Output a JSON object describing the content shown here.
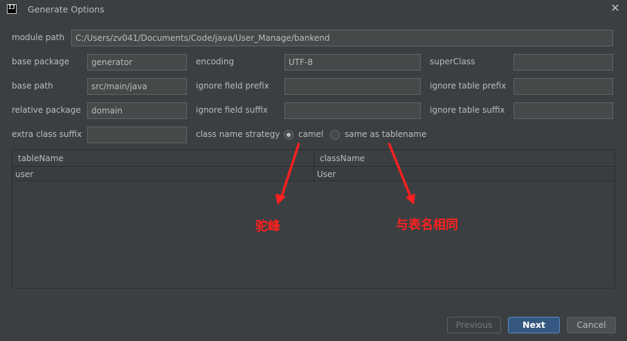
{
  "window": {
    "title": "Generate Options",
    "icon_text": "IJ"
  },
  "form": {
    "module_path": {
      "label": "module path",
      "value": "C:/Users/zv041/Documents/Code/java/User_Manage/bankend"
    },
    "base_package": {
      "label": "base package",
      "value": "generator"
    },
    "encoding": {
      "label": "encoding",
      "value": "UTF-8"
    },
    "super_class": {
      "label": "superClass",
      "value": ""
    },
    "base_path": {
      "label": "base path",
      "value": "src/main/java"
    },
    "ignore_field_prefix": {
      "label": "ignore field prefix",
      "value": ""
    },
    "ignore_table_prefix": {
      "label": "ignore table prefix",
      "value": ""
    },
    "relative_package": {
      "label": "relative package",
      "value": "domain"
    },
    "ignore_field_suffix": {
      "label": "ignore field suffix",
      "value": ""
    },
    "ignore_table_suffix": {
      "label": "ignore table suffix",
      "value": ""
    },
    "extra_class_suffix": {
      "label": "extra class suffix",
      "value": ""
    },
    "class_name_strategy": {
      "label": "class name strategy",
      "options": [
        "camel",
        "same as tablename"
      ],
      "selected": "camel"
    }
  },
  "table": {
    "columns": [
      "tableName",
      "className"
    ],
    "rows": [
      [
        "user",
        "User"
      ]
    ]
  },
  "annotations": {
    "camel_note": "驼峰",
    "same_note": "与表名相同",
    "color": "#ff2020"
  },
  "buttons": {
    "previous": "Previous",
    "next": "Next",
    "cancel": "Cancel"
  },
  "colors": {
    "background": "#3c3f41",
    "accent": "#365880",
    "text": "#bbbbbb"
  }
}
